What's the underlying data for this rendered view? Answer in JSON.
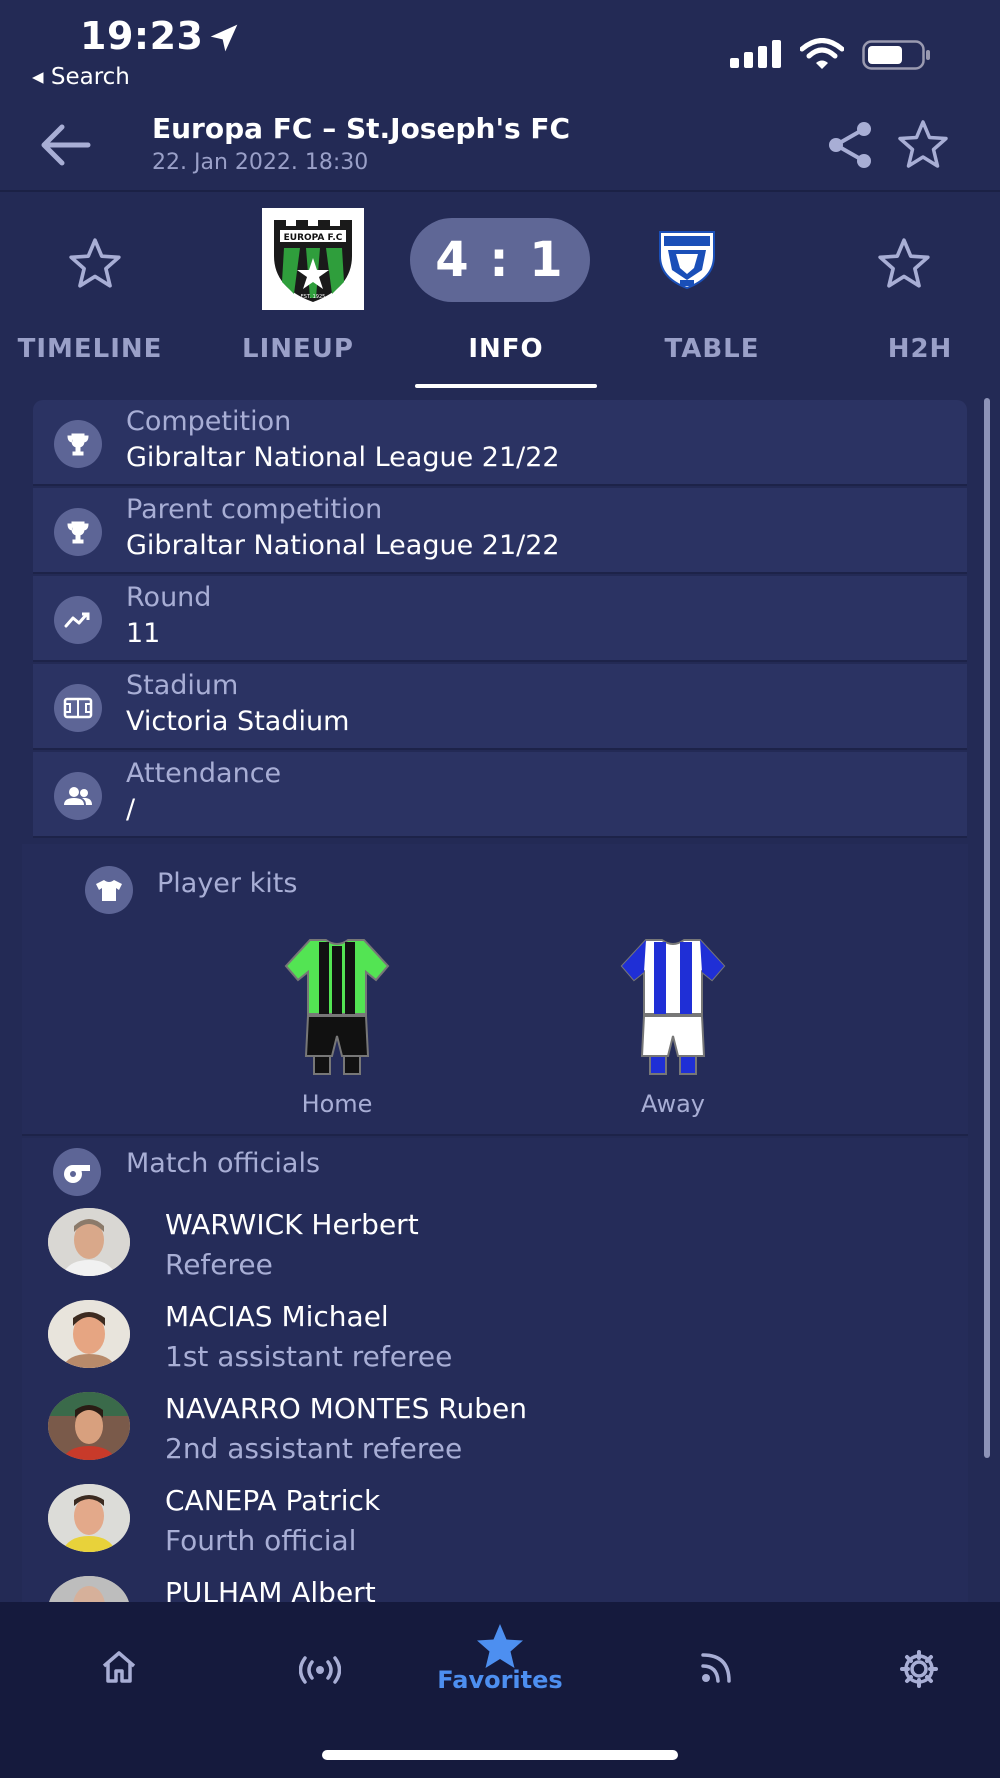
{
  "status_bar": {
    "time": "19:23",
    "back_label": "◂ Search"
  },
  "header": {
    "title": "Europa FC – St.Joseph's FC",
    "datetime": "22. Jan 2022. 18:30"
  },
  "score": {
    "text": "4 : 1"
  },
  "home_logo": {
    "name_text": "EUROPA F.C",
    "est_text": "EST. 1925"
  },
  "tabs": [
    {
      "label": "TIMELINE"
    },
    {
      "label": "LINEUP"
    },
    {
      "label": "INFO"
    },
    {
      "label": "TABLE"
    },
    {
      "label": "H2H"
    }
  ],
  "active_tab": "INFO",
  "info_rows": [
    {
      "label": "Competition",
      "value": "Gibraltar National League  21/22",
      "icon": "trophy-icon"
    },
    {
      "label": "Parent competition",
      "value": "Gibraltar National League  21/22",
      "icon": "trophy-icon"
    },
    {
      "label": "Round",
      "value": "11",
      "icon": "trend-icon"
    },
    {
      "label": "Stadium",
      "value": "Victoria Stadium",
      "icon": "pitch-icon"
    },
    {
      "label": "Attendance",
      "value": "/",
      "icon": "people-icon"
    }
  ],
  "kits": {
    "heading": "Player kits",
    "home_label": "Home",
    "away_label": "Away",
    "home_colors": {
      "shirt": "#53e453",
      "stripe": "#111111",
      "shorts": "#111111",
      "socks": "#111111"
    },
    "away_colors": {
      "shirt": "#ffffff",
      "stripe": "#1f2fd6",
      "shorts": "#ffffff",
      "socks": "#1f2fd6"
    }
  },
  "officials": {
    "heading": "Match officials",
    "list": [
      {
        "name": "WARWICK Herbert",
        "role": "Referee"
      },
      {
        "name": "MACIAS Michael",
        "role": "1st assistant referee"
      },
      {
        "name": "NAVARRO MONTES Ruben",
        "role": "2nd assistant referee"
      },
      {
        "name": "CANEPA Patrick",
        "role": "Fourth official"
      },
      {
        "name": "PULHAM Albert",
        "role": ""
      }
    ]
  },
  "bottom_nav": {
    "items": [
      {
        "icon": "home-icon"
      },
      {
        "icon": "live-icon"
      },
      {
        "icon": "star-icon",
        "label": "Favorites",
        "active": true
      },
      {
        "icon": "rss-icon"
      },
      {
        "icon": "gear-icon"
      }
    ]
  },
  "colors": {
    "background": "#232a55",
    "accent": "#4d8ff0",
    "pill": "#5f6796"
  }
}
